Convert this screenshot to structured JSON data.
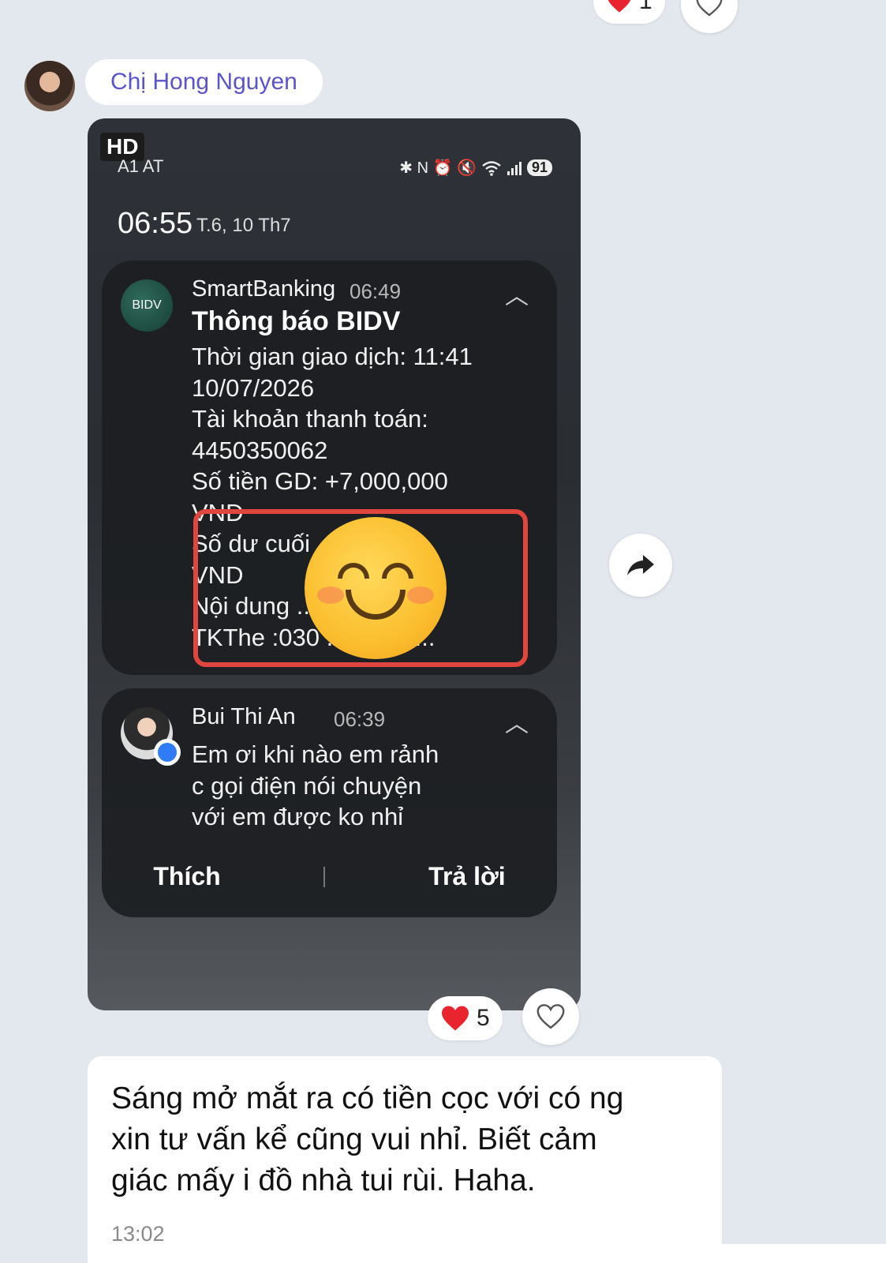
{
  "top_reaction": {
    "count": "1"
  },
  "sender": {
    "name": "Chị Hong Nguyen"
  },
  "phone": {
    "hd_label": "HD",
    "carrier": "A1 AT",
    "battery": "91",
    "status_glyphs": "✱ N ⏰ 🔇",
    "time": "06:55",
    "date": "T.6, 10 Th7"
  },
  "notif_bank": {
    "app": "SmartBanking",
    "time": "06:49",
    "title": "Thông báo BIDV",
    "icon_label": "BIDV",
    "lines": [
      "Thời gian giao dịch: 11:41",
      "10/07/2026",
      "Tài khoản thanh toán:",
      "4450350062",
      "Số tiền GD: +7,000,000",
      "VND",
      "Số dư cuối ... 234",
      "VND",
      "Nội dung ...",
      "TKThe :030 ... 623, t..."
    ]
  },
  "notif_msg": {
    "app": "Bui Thi An",
    "time": "06:39",
    "lines": [
      "Em ơi khi nào em rảnh",
      "c gọi điện nói chuyện",
      "với em được ko nhỉ"
    ],
    "action_like": "Thích",
    "action_reply": "Trả lời"
  },
  "photo_reaction": {
    "count": "5"
  },
  "message": {
    "text_lines": [
      "Sáng mở mắt ra có tiền cọc với có ng",
      "xin tư vấn kể cũng vui nhỉ. Biết cảm",
      "giác mấy i đồ nhà tui rùi. Haha."
    ],
    "time": "13:02"
  },
  "colors": {
    "sender_name": "#5a55c8",
    "highlight": "#e0463f",
    "heart": "#e8242f"
  }
}
